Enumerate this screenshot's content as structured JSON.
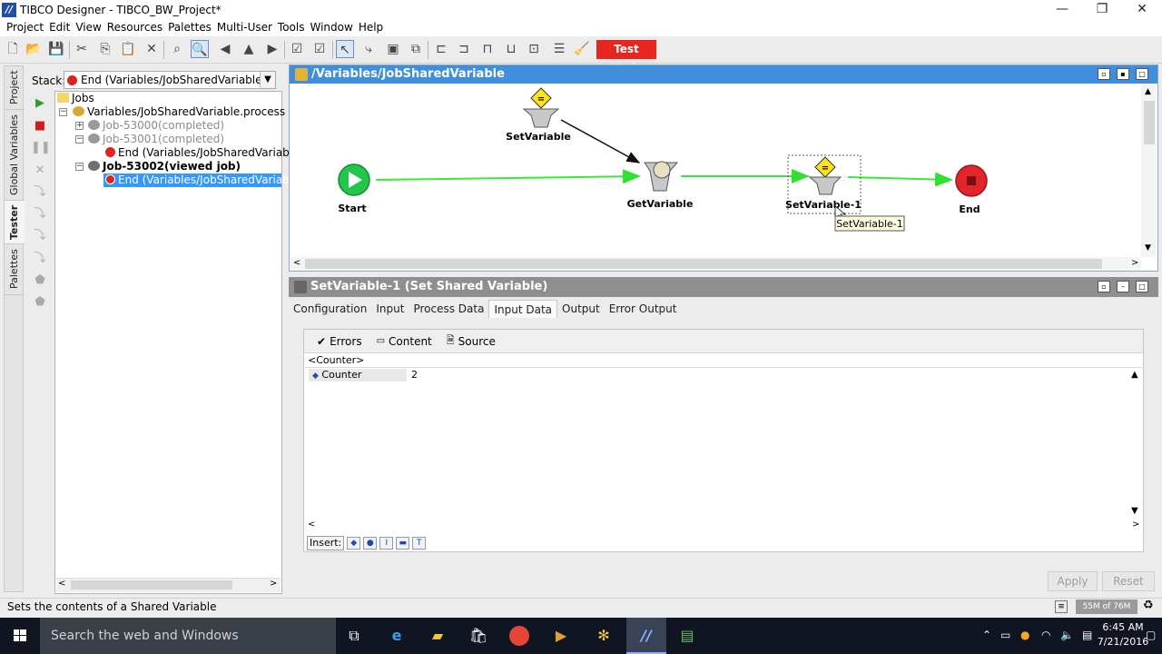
{
  "window": {
    "title": "TIBCO Designer - TIBCO_BW_Project*",
    "minimize": "—",
    "restore": "❐",
    "close": "✕"
  },
  "menu": [
    "Project",
    "Edit",
    "View",
    "Resources",
    "Palettes",
    "Multi-User",
    "Tools",
    "Window",
    "Help"
  ],
  "toolbar": {
    "test_mode": "Test Mode"
  },
  "side_tabs": {
    "project": "Project",
    "global_variables": "Global Variables",
    "tester": "Tester",
    "palettes": "Palettes"
  },
  "stack": {
    "label": "Stack:",
    "value": "End (Variables/JobSharedVariable...."
  },
  "tree": {
    "jobs": "Jobs",
    "process": "Variables/JobSharedVariable.process",
    "job1": "Job-53000(completed)",
    "job2": "Job-53001(completed)",
    "job2_end": "End (Variables/JobSharedVariable",
    "job3": "Job-53002(viewed job)",
    "job3_end": "End (Variables/JobSharedVariable"
  },
  "canvas": {
    "title": "/Variables/JobSharedVariable",
    "nodes": {
      "set_variable": "SetVariable",
      "start": "Start",
      "get_variable": "GetVariable",
      "set_variable_1": "SetVariable-1",
      "end": "End"
    },
    "tooltip": "SetVariable-1"
  },
  "activity": {
    "title": "SetVariable-1 (Set Shared Variable)",
    "tabs": [
      "Configuration",
      "Input",
      "Process Data",
      "Input Data",
      "Output",
      "Error Output"
    ],
    "active_tab": "Input Data",
    "toolbar": {
      "errors": "Errors",
      "content": "Content",
      "source": "Source"
    },
    "root": "<Counter>",
    "field_label": "Counter",
    "field_value": "2",
    "insert": "Insert:",
    "apply": "Apply",
    "reset": "Reset"
  },
  "status": {
    "text": "Sets the contents of a Shared Variable",
    "memory": "55M of 76M"
  },
  "taskbar": {
    "search": "Search the web and Windows",
    "time": "6:45 AM",
    "date": "7/21/2016"
  },
  "colors": {
    "canvas_title": "#3f8fdc",
    "test_mode": "#e8251e",
    "transition": "#3fe63f",
    "start": "#22c64a",
    "end": "#e0262a"
  }
}
